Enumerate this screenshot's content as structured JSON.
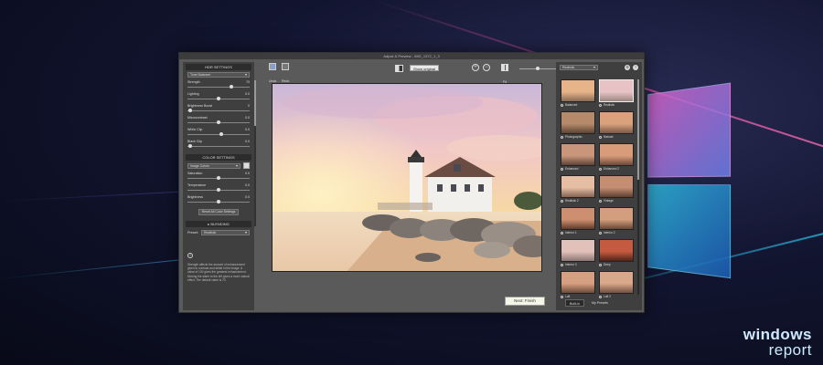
{
  "window": {
    "title": "Adjust & Preview - IMG_1372_1_3"
  },
  "left_panel": {
    "hdr_section_title": "HDR SETTINGS",
    "tone_mode": "Tone Balancer",
    "hdr_sliders": [
      {
        "label": "Strength",
        "value": "70",
        "level": 0.7
      },
      {
        "label": "Lighting",
        "value": "0.0",
        "level": 0.5
      },
      {
        "label": "Brightness Boost",
        "value": "0",
        "level": 0.05
      },
      {
        "label": "Microcontrast",
        "value": "0.0",
        "level": 0.5
      },
      {
        "label": "White Clip",
        "value": "0.0",
        "level": 0.55
      },
      {
        "label": "Black Clip",
        "value": "0.0",
        "level": 0.05
      }
    ],
    "color_section_title": "COLOR SETTINGS",
    "color_mode": "Image Colors",
    "color_sliders": [
      {
        "label": "Saturation",
        "value": "0.0",
        "level": 0.5
      },
      {
        "label": "Temperature",
        "value": "0.0",
        "level": 0.5
      },
      {
        "label": "Brightness",
        "value": "0.0",
        "level": 0.5
      }
    ],
    "reset_button": "Reset All Color Settings",
    "blending_section_title": "▸ BLENDING",
    "preset_label": "Preset:",
    "preset_value": "Realistic",
    "info_text": "Strength affects the amount of enhancement given to contrast and detail in the image. A value of 100 gives the greatest enhancement. Moving the slider to the left gives a more natural effect. The default value is 70."
  },
  "toolbar": {
    "undo_label": "Undo",
    "redo_label": "Redo",
    "compare_label": "Show original",
    "fit_label": "Fit",
    "zoom_value": "50%",
    "zoom_level": 0.5
  },
  "next_button": "Next: Finish",
  "right_panel": {
    "preset_filter": "Realistic",
    "help_icon": "?",
    "thumbnails": [
      {
        "label": "Balanced",
        "selected": false,
        "colors": [
          "#e7b48a",
          "#8a6a55"
        ]
      },
      {
        "label": "Realistic",
        "selected": true,
        "colors": [
          "#e8c3c6",
          "#9c8780"
        ]
      },
      {
        "label": "Photographic",
        "selected": false,
        "colors": [
          "#b58a6a",
          "#5d4335"
        ]
      },
      {
        "label": "Natural",
        "selected": false,
        "colors": [
          "#d9a27d",
          "#7a5847"
        ]
      },
      {
        "label": "Enhanced",
        "selected": false,
        "colors": [
          "#c9967b",
          "#5e4236"
        ]
      },
      {
        "label": "Enhanced 2",
        "selected": false,
        "colors": [
          "#d99c7b",
          "#6c4837"
        ]
      },
      {
        "label": "Realistic 2",
        "selected": false,
        "colors": [
          "#e5bea3",
          "#826454"
        ]
      },
      {
        "label": "Vintage",
        "selected": false,
        "colors": [
          "#c58e72",
          "#5a3e31"
        ]
      },
      {
        "label": "Interior 1",
        "selected": false,
        "colors": [
          "#cd8f6f",
          "#5e3b2b"
        ]
      },
      {
        "label": "Interior 2",
        "selected": false,
        "colors": [
          "#d39e7d",
          "#684736"
        ]
      },
      {
        "label": "Interior 3",
        "selected": false,
        "colors": [
          "#e3c1bb",
          "#8b7673"
        ]
      },
      {
        "label": "Deep",
        "selected": false,
        "colors": [
          "#c45a3f",
          "#4e2318"
        ]
      },
      {
        "label": "Loft",
        "selected": false,
        "colors": [
          "#d5a081",
          "#6b4a39"
        ]
      },
      {
        "label": "Loft 2",
        "selected": false,
        "colors": [
          "#d9a789",
          "#735040"
        ]
      }
    ],
    "tab_builtin": "Built-in",
    "tab_mypresets": "My Presets"
  },
  "brand": {
    "line1": "windows",
    "line2": "report"
  }
}
